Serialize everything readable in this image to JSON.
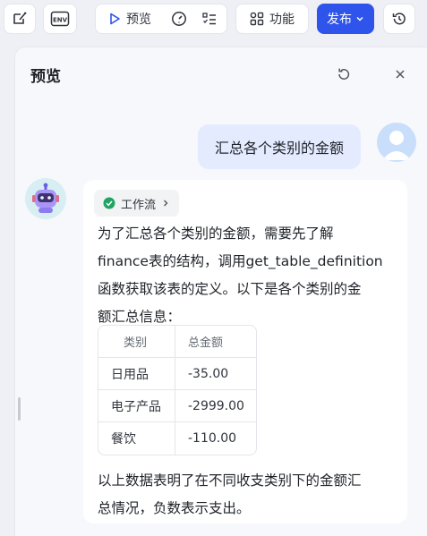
{
  "toolbar": {
    "icon_left_1": "ai-edit-icon",
    "icon_left_2": "env-icon",
    "env_label": "ENV",
    "preview_label": "预览",
    "feature_label": "功能",
    "publish_label": "发布"
  },
  "panel": {
    "title": "预览"
  },
  "chat": {
    "user_message": "汇总各个类别的金额",
    "workflow_label": "工作流",
    "intro_lines": [
      "为了汇总各个类别的金额，需要先了解",
      "finance表的结构，调用get_table_definition",
      "函数获取该表的定义。以下是各个类别的金",
      "额汇总信息："
    ],
    "table": {
      "headers": [
        "类别",
        "总金额"
      ],
      "rows": [
        [
          "日用品",
          "-35.00"
        ],
        [
          "电子产品",
          "-2999.00"
        ],
        [
          "餐饮",
          "-110.00"
        ]
      ]
    },
    "outro_lines": [
      "以上数据表明了在不同收支类别下的金额汇",
      "总情况，负数表示支出。"
    ]
  },
  "colors": {
    "accent": "#2f54eb",
    "user_bubble": "#e4ebff",
    "success": "#1fa463"
  }
}
